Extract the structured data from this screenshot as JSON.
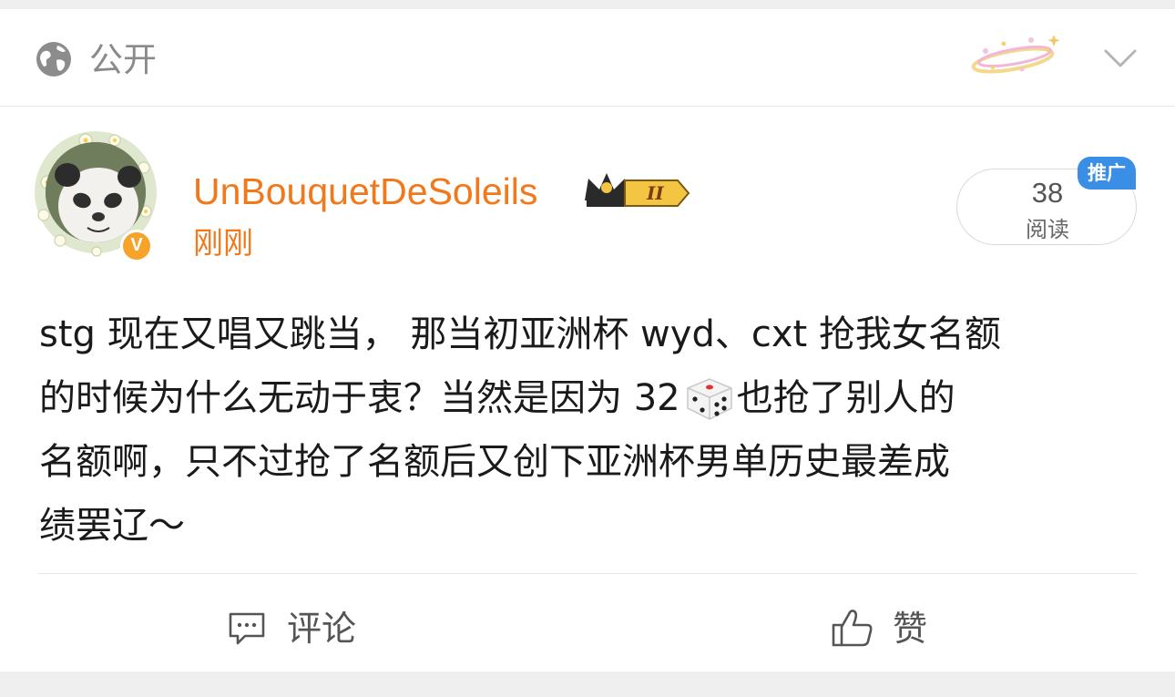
{
  "header": {
    "visibility_label": "公开",
    "icons": {
      "visibility": "globe-icon",
      "decoration": "sparkle-decoration-icon",
      "menu": "chevron-down-icon"
    }
  },
  "author": {
    "username": "UnBouquetDeSoleils",
    "timestamp": "刚刚",
    "verified": true,
    "badge": "crown-level-badge-icon",
    "name_color": "#f1781b"
  },
  "stats": {
    "read_count": "38",
    "read_label": "阅读",
    "promo_label": "推广",
    "promo_color": "#3a8ee6"
  },
  "post": {
    "line1": "stg 现在又唱又跳当， 那当初亚洲杯 wyd、cxt 抢我女名额",
    "line2_before": "的时候为什么无动于衷？当然是因为 32",
    "line2_after": "也抢了别人的",
    "line3": "名额啊，只不过抢了名额后又创下亚洲杯男单历史最差成",
    "line4": "绩罢辽～",
    "inline_icon": "dice-icon"
  },
  "actions": {
    "comment_label": "评论",
    "like_label": "赞"
  }
}
